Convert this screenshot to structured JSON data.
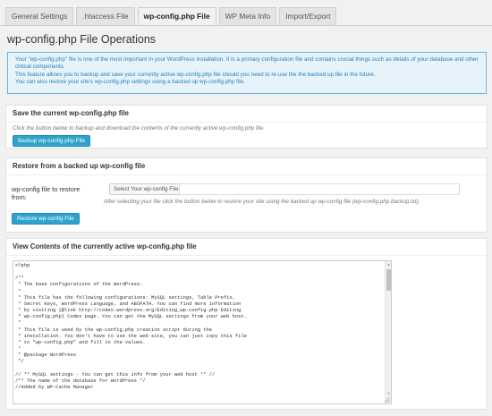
{
  "tabs": [
    {
      "label": "General Settings"
    },
    {
      "label": ".htaccess File"
    },
    {
      "label": "wp-config.php File"
    },
    {
      "label": "WP Meta Info"
    },
    {
      "label": "Import/Export"
    }
  ],
  "active_tab": 2,
  "page_title": "wp-config.php File Operations",
  "info": {
    "line1": "Your \"wp-config.php\" file is one of the most important in your WordPress installation. It is a primary configuration file and contains crucial things such as details of your database and other critical components.",
    "line2": "This feature allows you to backup and save your currently active wp-config.php file should you need to re-use the the backed up file in the future.",
    "line3": "You can also restore your site's wp-config.php settings using a backed up wp-config.php file."
  },
  "save_panel": {
    "title": "Save the current wp-config.php file",
    "hint": "Click the button below to backup and download the contents of the currently active wp-config.php file.",
    "button": "Backup wp-config.php File"
  },
  "restore_panel": {
    "title": "Restore from a backed up wp-config file",
    "field_label": "wp-config file to restore from:",
    "file_button": "Select Your wp-config File",
    "file_value": "",
    "hint": "After selecting your file click the button below to restore your site using the backed up wp-config file (wp-config.php.backup.txt).",
    "button": "Restore wp-config File"
  },
  "view_panel": {
    "title": "View Contents of the currently active wp-config.php file",
    "code": "<?php\n\n/**\n * The base configurations of the WordPress.\n *\n * This file has the following configurations: MySQL settings, Table Prefix,\n * Secret Keys, WordPress Language, and ABSPATH. You can find more information\n * by visiting {@link http://codex.wordpress.org/Editing_wp-config.php Editing\n * wp-config.php} Codex page. You can get the MySQL settings from your web host.\n *\n * This file is used by the wp-config.php creation script during the\n * installation. You don't have to use the web site, you can just copy this file\n * to \"wp-config.php\" and fill in the values.\n *\n * @package WordPress\n */\n\n// ** MySQL settings - You can get this info from your web host ** //\n/** The name of the database for WordPress */\n//Added by WP-Cache Manager"
  }
}
